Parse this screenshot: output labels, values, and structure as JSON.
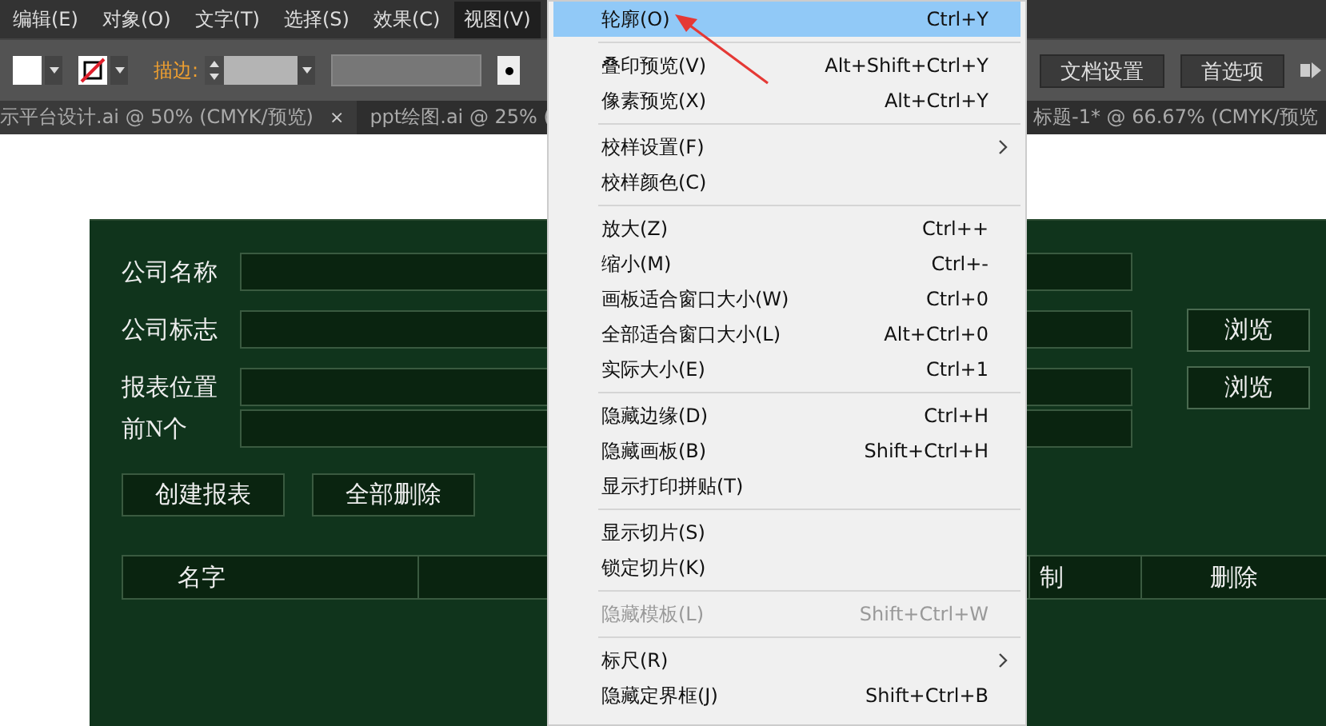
{
  "menu_bar": [
    {
      "label": "编辑(E)",
      "selected": false
    },
    {
      "label": "对象(O)",
      "selected": false
    },
    {
      "label": "文字(T)",
      "selected": false
    },
    {
      "label": "选择(S)",
      "selected": false
    },
    {
      "label": "效果(C)",
      "selected": false
    },
    {
      "label": "视图(V)",
      "selected": true
    }
  ],
  "toolbar": {
    "stroke_label": "描边:",
    "buttons": [
      "文档设置",
      "首选项"
    ]
  },
  "doc_tabs": [
    {
      "title": "示平台设计.ai @ 50% (CMYK/预览)",
      "close": "×",
      "selected": true
    },
    {
      "title": "ppt绘图.ai @ 25% (",
      "selected": false
    },
    {
      "title": "标题-1* @ 66.67% (CMYK/预览",
      "selected": false
    }
  ],
  "form": {
    "fields": [
      {
        "label": "公司名称"
      },
      {
        "label": "公司标志",
        "browse": "浏览"
      },
      {
        "label": "报表位置",
        "browse": "浏览"
      },
      {
        "label": "前N个"
      }
    ],
    "buttons": [
      "创建报表",
      "全部删除"
    ],
    "table": {
      "columns": [
        "名字",
        "制",
        "删除"
      ]
    }
  },
  "view_menu": [
    {
      "kind": "item",
      "label": "轮廓(O)",
      "shortcut": "Ctrl+Y",
      "selected": true,
      "disabled": false,
      "submenu": false
    },
    {
      "kind": "separator"
    },
    {
      "kind": "item",
      "label": "叠印预览(V)",
      "shortcut": "Alt+Shift+Ctrl+Y",
      "selected": false,
      "disabled": false,
      "submenu": false
    },
    {
      "kind": "item",
      "label": "像素预览(X)",
      "shortcut": "Alt+Ctrl+Y",
      "selected": false,
      "disabled": false,
      "submenu": false
    },
    {
      "kind": "separator"
    },
    {
      "kind": "item",
      "label": "校样设置(F)",
      "selected": false,
      "disabled": false,
      "submenu": true
    },
    {
      "kind": "item",
      "label": "校样颜色(C)",
      "selected": false,
      "disabled": false,
      "submenu": false
    },
    {
      "kind": "separator"
    },
    {
      "kind": "item",
      "label": "放大(Z)",
      "shortcut": "Ctrl++",
      "selected": false,
      "disabled": false,
      "submenu": false
    },
    {
      "kind": "item",
      "label": "缩小(M)",
      "shortcut": "Ctrl+-",
      "selected": false,
      "disabled": false,
      "submenu": false
    },
    {
      "kind": "item",
      "label": "画板适合窗口大小(W)",
      "shortcut": "Ctrl+0",
      "selected": false,
      "disabled": false,
      "submenu": false
    },
    {
      "kind": "item",
      "label": "全部适合窗口大小(L)",
      "shortcut": "Alt+Ctrl+0",
      "selected": false,
      "disabled": false,
      "submenu": false
    },
    {
      "kind": "item",
      "label": "实际大小(E)",
      "shortcut": "Ctrl+1",
      "selected": false,
      "disabled": false,
      "submenu": false
    },
    {
      "kind": "separator"
    },
    {
      "kind": "item",
      "label": "隐藏边缘(D)",
      "shortcut": "Ctrl+H",
      "selected": false,
      "disabled": false,
      "submenu": false
    },
    {
      "kind": "item",
      "label": "隐藏画板(B)",
      "shortcut": "Shift+Ctrl+H",
      "selected": false,
      "disabled": false,
      "submenu": false
    },
    {
      "kind": "item",
      "label": "显示打印拼贴(T)",
      "selected": false,
      "disabled": false,
      "submenu": false
    },
    {
      "kind": "separator"
    },
    {
      "kind": "item",
      "label": "显示切片(S)",
      "selected": false,
      "disabled": false,
      "submenu": false
    },
    {
      "kind": "item",
      "label": "锁定切片(K)",
      "selected": false,
      "disabled": false,
      "submenu": false
    },
    {
      "kind": "separator"
    },
    {
      "kind": "item",
      "label": "隐藏模板(L)",
      "shortcut": "Shift+Ctrl+W",
      "selected": false,
      "disabled": true,
      "submenu": false
    },
    {
      "kind": "separator"
    },
    {
      "kind": "item",
      "label": "标尺(R)",
      "selected": false,
      "disabled": false,
      "submenu": true
    },
    {
      "kind": "item",
      "label": "隐藏定界框(J)",
      "shortcut": "Shift+Ctrl+B",
      "selected": false,
      "disabled": false,
      "submenu": false
    }
  ]
}
